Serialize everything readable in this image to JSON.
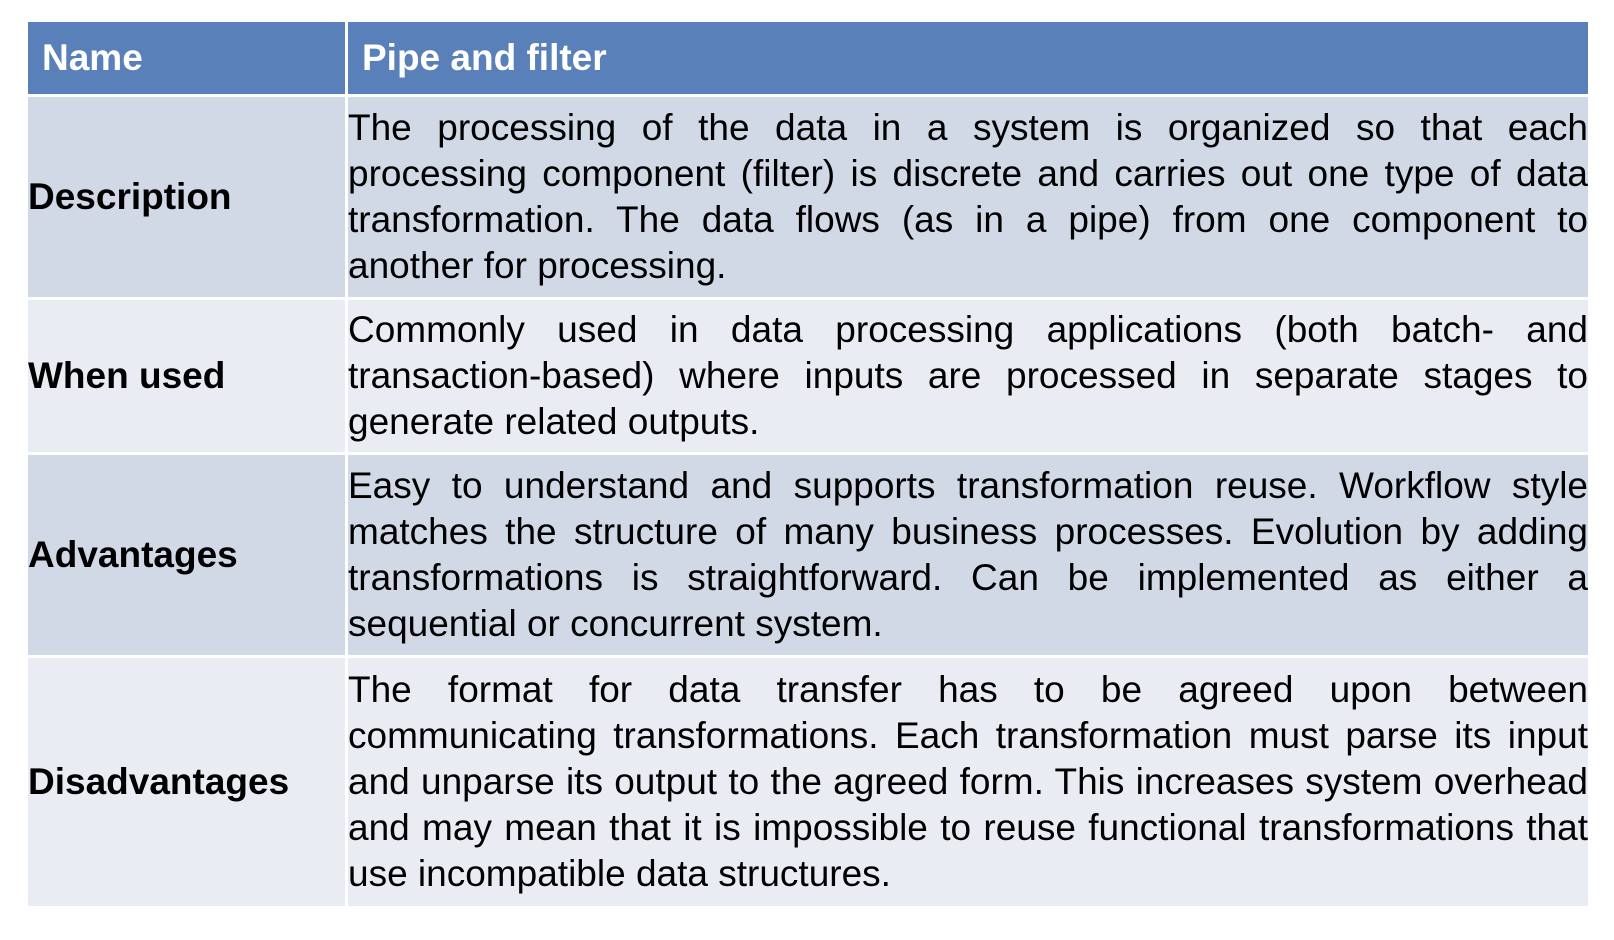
{
  "table": {
    "header": {
      "key": "Name",
      "value": "Pipe and filter"
    },
    "rows": [
      {
        "key": "Description",
        "value": "The processing of the data in a system is organized so that each processing component (filter) is discrete and carries out one type of data transformation. The data flows (as in a pipe) from one component to another for processing."
      },
      {
        "key": "When used",
        "value": "Commonly used in data processing applications (both batch- and transaction-based) where inputs are processed in separate stages to generate related outputs."
      },
      {
        "key": "Advantages",
        "value": "Easy to understand and supports transformation reuse. Workflow style matches the structure of many business processes. Evolution by adding transformations is straightforward. Can be implemented as either a sequential or concurrent system."
      },
      {
        "key": "Disadvantages",
        "value": "The format for data transfer has to be agreed upon between communicating transformations. Each transformation must parse its input and unparse its output to the agreed form. This increases system overhead and may mean that it is impossible to reuse functional transformations that use incompatible data structures."
      }
    ]
  },
  "colors": {
    "header_bg": "#5a80b9",
    "row_dark": "#d1d8e6",
    "row_light": "#e9ecf3"
  }
}
